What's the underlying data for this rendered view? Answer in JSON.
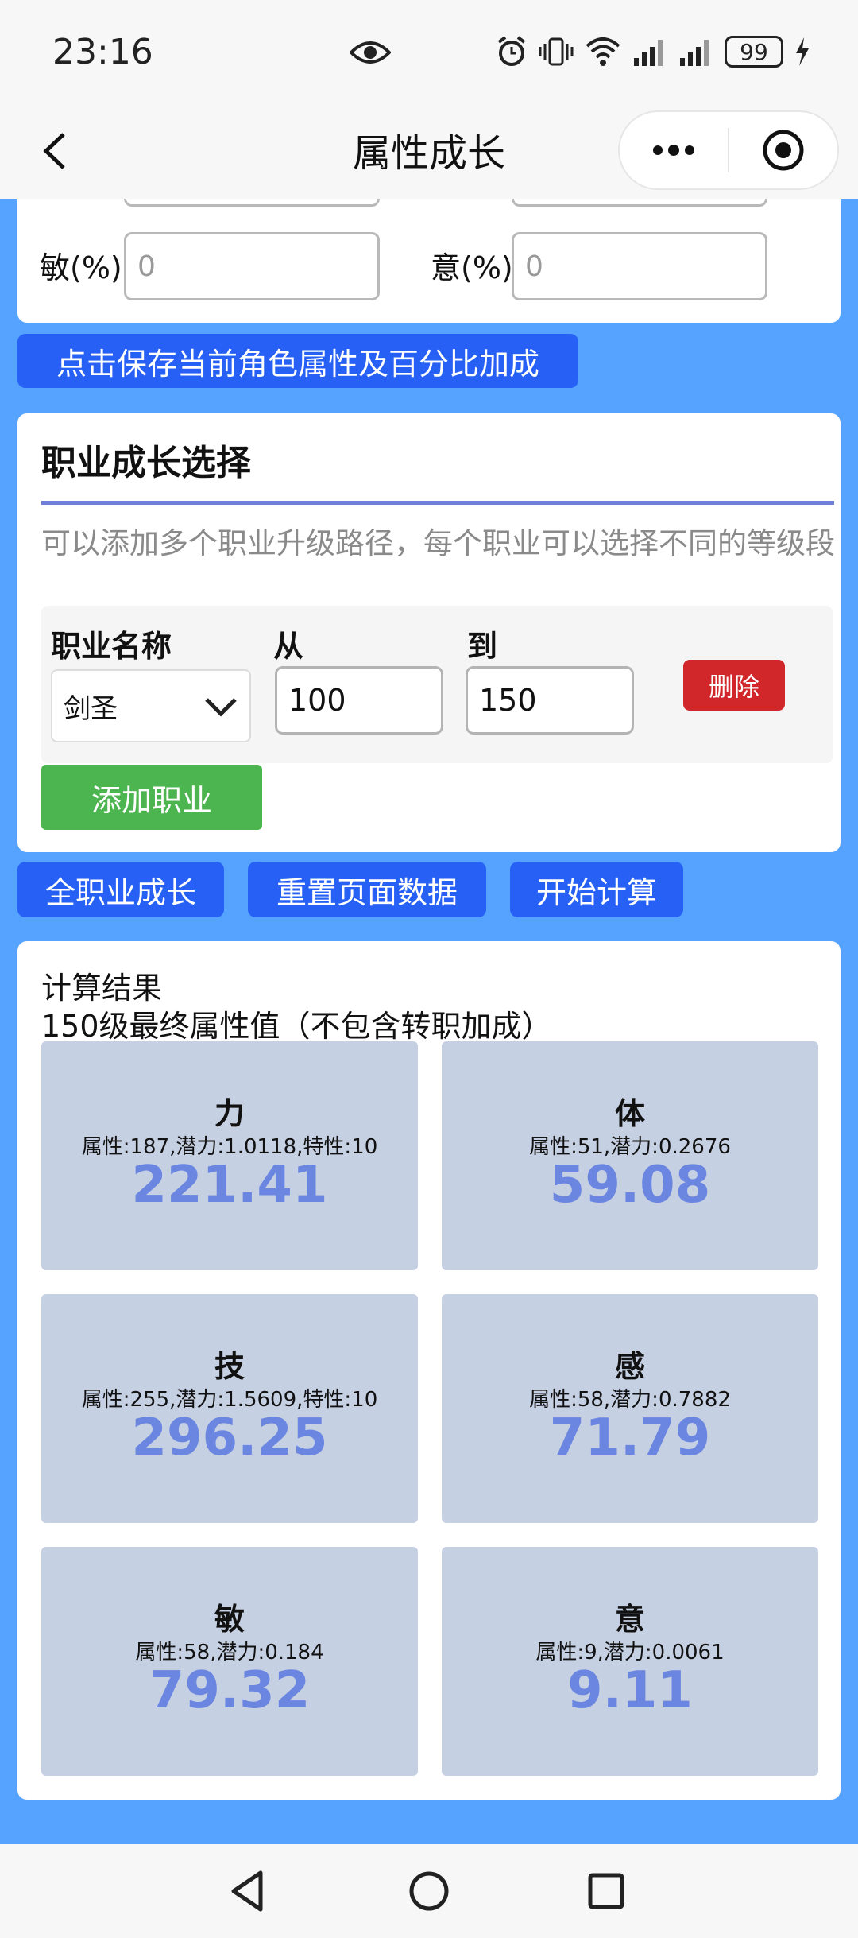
{
  "status_bar": {
    "time": "23:16",
    "battery": "99",
    "icons": [
      "eye-icon",
      "alarm-icon",
      "vibrate-icon",
      "wifi-icon",
      "signal-icon",
      "signal-icon",
      "charging-icon"
    ]
  },
  "nav": {
    "title": "属性成长",
    "capsule_icons": [
      "more-icon",
      "target-icon"
    ]
  },
  "percent_inputs": {
    "agi_label": "敏(%)",
    "agi_value": "0",
    "will_label": "意(%)",
    "will_value": "0"
  },
  "save_button": "点击保存当前角色属性及百分比加成",
  "job_section": {
    "title": "职业成长选择",
    "hint": "可以添加多个职业升级路径，每个职业可以选择不同的等级段",
    "col_name": "职业名称",
    "col_from": "从",
    "col_to": "到",
    "job_name": "剑圣",
    "from_level": "100",
    "to_level": "150",
    "delete_label": "删除",
    "add_label": "添加职业"
  },
  "actions": {
    "all_growth": "全职业成长",
    "reset": "重置页面数据",
    "calculate": "开始计算"
  },
  "result": {
    "title": "计算结果",
    "subtitle": "150级最终属性值（不包含转职加成）",
    "stats": [
      {
        "name": "力",
        "detail": "属性:187,潜力:1.0118,特性:10",
        "value": "221.41"
      },
      {
        "name": "体",
        "detail": "属性:51,潜力:0.2676",
        "value": "59.08"
      },
      {
        "name": "技",
        "detail": "属性:255,潜力:1.5609,特性:10",
        "value": "296.25"
      },
      {
        "name": "感",
        "detail": "属性:58,潜力:0.7882",
        "value": "71.79"
      },
      {
        "name": "敏",
        "detail": "属性:58,潜力:0.184",
        "value": "79.32"
      },
      {
        "name": "意",
        "detail": "属性:9,潜力:0.0061",
        "value": "9.11"
      }
    ]
  },
  "colors": {
    "page_bg": "#55a3ff",
    "primary": "#2660f5",
    "danger": "#d1262a",
    "success": "#4cb54f",
    "stat_bg": "#c6d0e3",
    "stat_value": "#6b86e0"
  },
  "system_nav": [
    "back-icon",
    "home-icon",
    "recents-icon"
  ]
}
